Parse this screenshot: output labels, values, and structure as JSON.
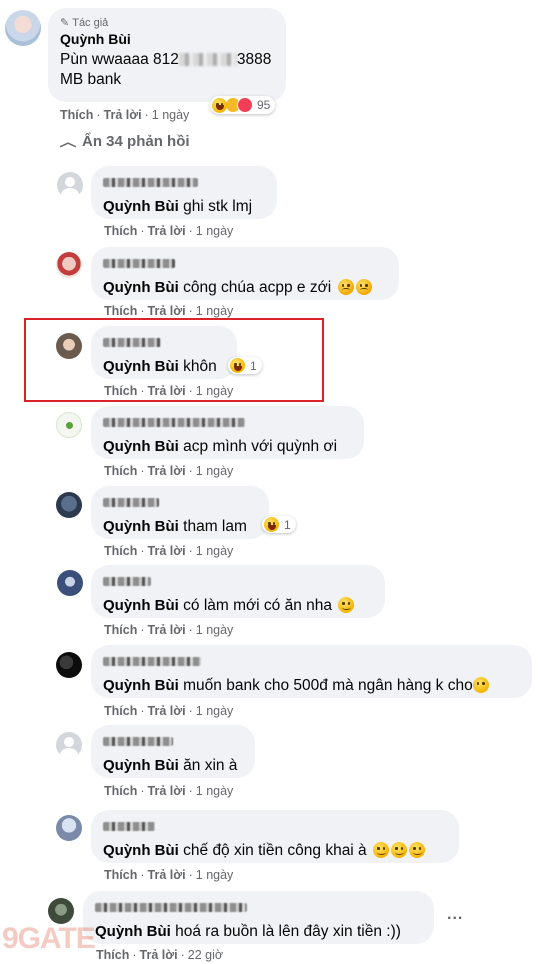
{
  "main_comment": {
    "author_badge": "Tác giả",
    "author": "Quỳnh Bùi",
    "line1": "Pùn wwaaaa 812",
    "line1_tail": "3888",
    "line2": "MB bank",
    "like": "Thích",
    "reply": "Trả lời",
    "time": "1 ngày",
    "reaction_count": "95"
  },
  "hide_replies": "Ẩn 34 phản hồi",
  "replies": [
    {
      "mention": "Quỳnh Bùi",
      "text": "ghi stk lmj",
      "like": "Thích",
      "reply": "Trả lời",
      "time": "1 ngày"
    },
    {
      "mention": "Quỳnh Bùi",
      "text": "công chúa acpp e zới",
      "like": "Thích",
      "reply": "Trả lời",
      "time": "1 ngày"
    },
    {
      "mention": "Quỳnh Bùi",
      "text": "khôn",
      "like": "Thích",
      "reply": "Trả lời",
      "time": "1 ngày",
      "reaction_count": "1"
    },
    {
      "mention": "Quỳnh Bùi",
      "text": "acp mình với quỳnh ơi",
      "like": "Thích",
      "reply": "Trả lời",
      "time": "1 ngày"
    },
    {
      "mention": "Quỳnh Bùi",
      "text": "tham lam",
      "like": "Thích",
      "reply": "Trả lời",
      "time": "1 ngày",
      "reaction_count": "1"
    },
    {
      "mention": "Quỳnh Bùi",
      "text": "có làm mới có ăn nha",
      "like": "Thích",
      "reply": "Trả lời",
      "time": "1 ngày"
    },
    {
      "mention": "Quỳnh Bùi",
      "text": "muốn bank cho 500đ mà ngân hàng k cho",
      "like": "Thích",
      "reply": "Trả lời",
      "time": "1 ngày"
    },
    {
      "mention": "Quỳnh Bùi",
      "text": "ăn xin à",
      "like": "Thích",
      "reply": "Trả lời",
      "time": "1 ngày"
    },
    {
      "mention": "Quỳnh Bùi",
      "text": "chế độ xin tiền công khai à",
      "like": "Thích",
      "reply": "Trả lời",
      "time": "1 ngày"
    },
    {
      "mention": "Quỳnh Bùi",
      "text": "hoá ra buồn là lên đây xin tiền :))",
      "like": "Thích",
      "reply": "Trả lời",
      "time": "22 giờ"
    }
  ],
  "more_options": "...",
  "watermark": "9GATE"
}
